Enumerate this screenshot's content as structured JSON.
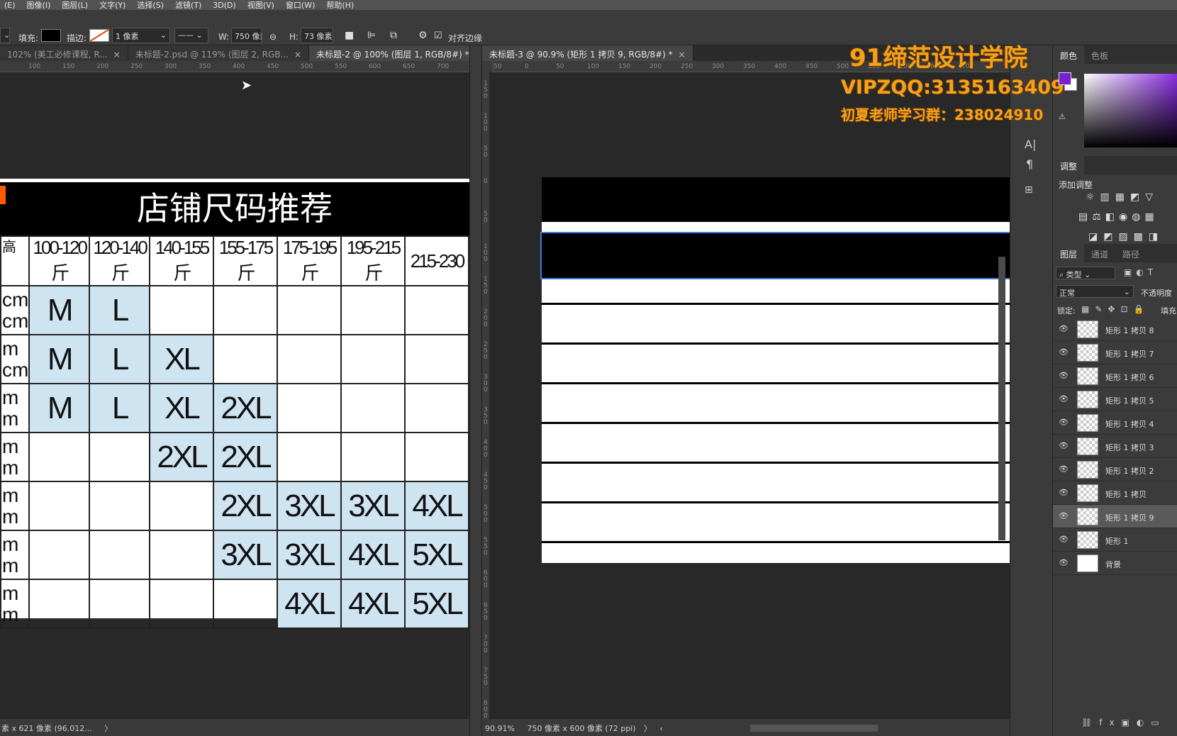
{
  "menu": [
    "(E)",
    "图像(I)",
    "图层(L)",
    "文字(Y)",
    "选择(S)",
    "滤镜(T)",
    "3D(D)",
    "视图(V)",
    "窗口(W)",
    "帮助(H)"
  ],
  "options": {
    "fill_label": "填充:",
    "stroke_label": "描边:",
    "stroke_width": "1 像素",
    "w_label": "W:",
    "w_value": "750 像素",
    "h_label": "H:",
    "h_value": "73 像素",
    "align_edges": "对齐边缘",
    "colors": {
      "fill": "#000000",
      "accent": "#e33e00"
    }
  },
  "tabs_left": [
    {
      "label": "102% (美工必修课程, R...",
      "close": "×"
    },
    {
      "label": "未标题-2.psd @ 119% (图层 2, RGB...",
      "close": "×"
    },
    {
      "label": "未标题-2 @ 100% (图层 1, RGB/8#) *",
      "close": "×"
    }
  ],
  "tabs_right": [
    {
      "label": "未标题-3 @ 90.9% (矩形 1 拷贝 9, RGB/8#) *",
      "close": "×"
    }
  ],
  "ruler_left": [
    "100",
    "150",
    "200",
    "250",
    "300",
    "350",
    "400",
    "450",
    "500",
    "550",
    "600",
    "650",
    "700"
  ],
  "ruler_right": [
    "50",
    "0",
    "50",
    "100",
    "150",
    "200",
    "250",
    "300",
    "350",
    "400",
    "450",
    "500",
    "550",
    "600",
    "650",
    "700"
  ],
  "ruler_vertical": [
    "150",
    "100",
    "50",
    "0",
    "50",
    "100",
    "150",
    "200",
    "250",
    "300",
    "350",
    "400",
    "450",
    "500",
    "550",
    "600",
    "650",
    "700",
    "750",
    "800"
  ],
  "size_chart": {
    "title": "店铺尺码推荐",
    "corner": "高",
    "headers": [
      "100-120 斤",
      "120-140 斤",
      "140-155 斤",
      "155-175 斤",
      "175-195 斤",
      "195-215 斤",
      "215-230"
    ],
    "row_heads": [
      "cm\ncm",
      "m\ncm",
      "m\nm",
      "m\nm",
      "m\nm",
      "m\nm",
      "m\nm"
    ],
    "rows": [
      [
        "M",
        "L",
        "",
        "",
        "",
        "",
        ""
      ],
      [
        "M",
        "L",
        "XL",
        "",
        "",
        "",
        ""
      ],
      [
        "M",
        "L",
        "XL",
        "2XL",
        "",
        "",
        ""
      ],
      [
        "",
        "",
        "2XL",
        "2XL",
        "",
        "",
        ""
      ],
      [
        "",
        "",
        "",
        "2XL",
        "3XL",
        "3XL",
        "4XL"
      ],
      [
        "",
        "",
        "",
        "3XL",
        "3XL",
        "4XL",
        "5XL"
      ],
      [
        "",
        "",
        "",
        "",
        "4XL",
        "4XL",
        "5XL"
      ]
    ],
    "highlight_color": "#cfe4f1"
  },
  "status_left": "素 x 621 像素 (96.012...",
  "status_right": {
    "zoom": "90.91%",
    "doc": "750 像素 x 600 像素 (72 ppi)"
  },
  "panels": {
    "color_tabs": [
      "颜色",
      "色板"
    ],
    "adjust_tab": "调整",
    "adjust_label": "添加调整",
    "layers_tabs": [
      "图层",
      "通道",
      "路径"
    ],
    "kind_filter": "类型",
    "blend_mode": "正常",
    "opacity_label": "不透明度",
    "lock_label": "锁定:",
    "fill_label": "填充",
    "foreground_color": "#7a1fd2",
    "layers": [
      {
        "name": "矩形 1 拷贝 8",
        "selected": false
      },
      {
        "name": "矩形 1 拷贝 7",
        "selected": false
      },
      {
        "name": "矩形 1 拷贝 6",
        "selected": false
      },
      {
        "name": "矩形 1 拷贝 5",
        "selected": false
      },
      {
        "name": "矩形 1 拷贝 4",
        "selected": false
      },
      {
        "name": "矩形 1 拷贝 3",
        "selected": false
      },
      {
        "name": "矩形 1 拷贝 2",
        "selected": false
      },
      {
        "name": "矩形 1 拷贝",
        "selected": false
      },
      {
        "name": "矩形 1 拷贝 9",
        "selected": true
      },
      {
        "name": "矩形 1",
        "selected": false
      },
      {
        "name": "背景",
        "selected": false
      }
    ]
  },
  "watermark": {
    "line1": "91缔范设计学院",
    "line2": "VIPZQQ:3135163409",
    "line3": "初夏老师学习群：238024910"
  }
}
